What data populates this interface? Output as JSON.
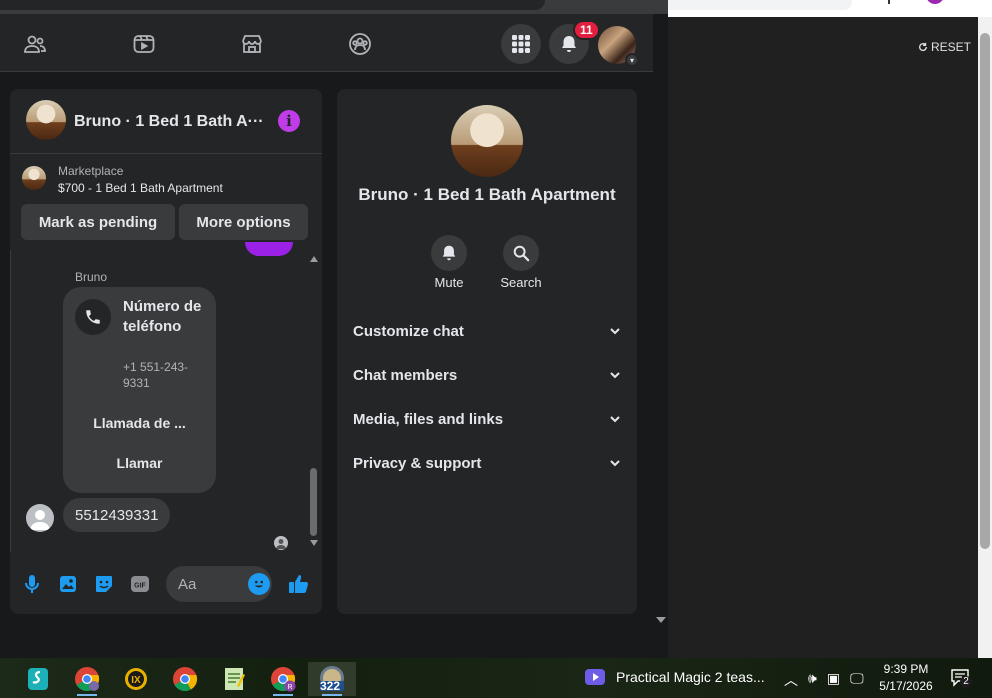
{
  "facebook": {
    "nav": {
      "notifications_badge": "11",
      "icons": [
        "friends-icon",
        "watch-icon",
        "marketplace-icon",
        "groups-icon",
        "menu-grid-icon",
        "bell-icon"
      ]
    },
    "chat": {
      "title": "Bruno · 1 Bed 1 Bath A···",
      "marketplace_label": "Marketplace",
      "listing_title": "$700 - 1 Bed 1 Bath Apartment",
      "mark_pending_label": "Mark as pending",
      "more_options_label": "More options",
      "sender_name": "Bruno",
      "call_card": {
        "title": "Número de teléfono",
        "number": "+1 551-243-9331",
        "call_from_label": "Llamada de ...",
        "call_label": "Llamar"
      },
      "message_text": "5512439331",
      "input_placeholder": "Aa"
    },
    "info_panel": {
      "name": "Bruno · 1 Bed 1 Bath Apartment",
      "actions": [
        {
          "label": "Mute",
          "icon": "bell-icon"
        },
        {
          "label": "Search",
          "icon": "search-icon"
        }
      ],
      "sections": [
        {
          "label": "Customize chat"
        },
        {
          "label": "Chat members"
        },
        {
          "label": "Media, files and links"
        },
        {
          "label": "Privacy & support"
        }
      ]
    }
  },
  "right_window": {
    "reset_label": "RESET"
  },
  "taskbar": {
    "media_title": "Practical Magic 2 teas...",
    "pinned_badge": "322",
    "time": "9:39 PM",
    "date": "5/17/2026",
    "notification_count": "2"
  },
  "colors": {
    "accent_purple": "#c03ce8",
    "messenger_blue": "#1d9bf0",
    "badge_red": "#e41e3f",
    "surface": "#242526",
    "background": "#18191a"
  }
}
